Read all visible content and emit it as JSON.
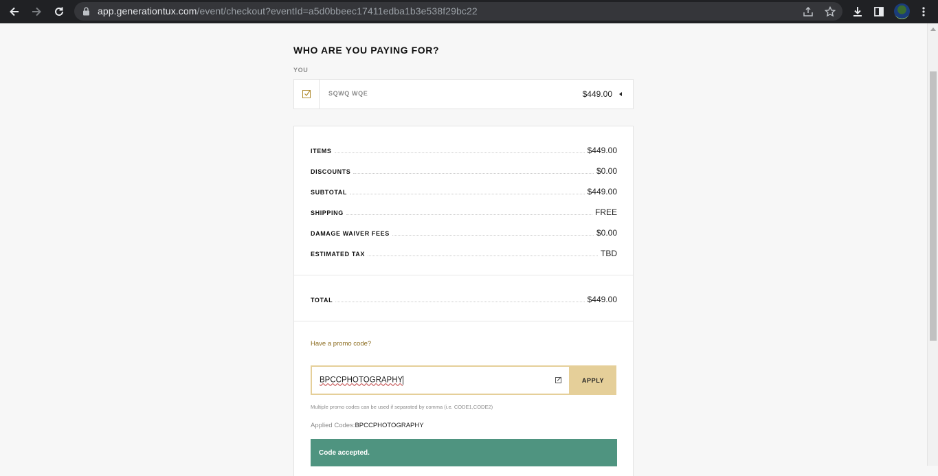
{
  "browser": {
    "url_host": "app.generationtux.com",
    "url_path": "/event/checkout?eventId=a5d0bbeec17411edba1b3e538f29bc22",
    "icons": [
      "back-icon",
      "forward-icon",
      "reload-icon",
      "lock-icon",
      "share-icon",
      "star-icon",
      "download-icon",
      "sidebar-icon",
      "avatar",
      "menu-icon"
    ]
  },
  "checkout": {
    "title": "WHO ARE YOU PAYING FOR?",
    "you_label": "YOU",
    "person": {
      "name": "SQWQ WQE",
      "price": "$449.00",
      "checked": true
    }
  },
  "summary": {
    "items": [
      {
        "label": "ITEMS",
        "value": "$449.00"
      },
      {
        "label": "DISCOUNTS",
        "value": "$0.00"
      },
      {
        "label": "SUBTOTAL",
        "value": "$449.00"
      },
      {
        "label": "SHIPPING",
        "value": "FREE"
      },
      {
        "label": "DAMAGE WAIVER FEES",
        "value": "$0.00"
      },
      {
        "label": "ESTIMATED TAX",
        "value": "TBD"
      }
    ],
    "total": {
      "label": "TOTAL",
      "value": "$449.00"
    }
  },
  "promo": {
    "link_text": "Have a promo code?",
    "input_value": "BPCCPHOTOGRAPHY",
    "apply_label": "APPLY",
    "hint": "Multiple promo codes can be used if separated by comma (i.e. CODE1,CODE2)",
    "applied_label": "Applied Codes:",
    "applied_codes": "BPCCPHOTOGRAPHY",
    "accepted_message": "Code accepted."
  },
  "colors": {
    "accent_gold": "#e5cf99",
    "link_gold": "#8a6a1c",
    "success_green": "#4f9480"
  }
}
